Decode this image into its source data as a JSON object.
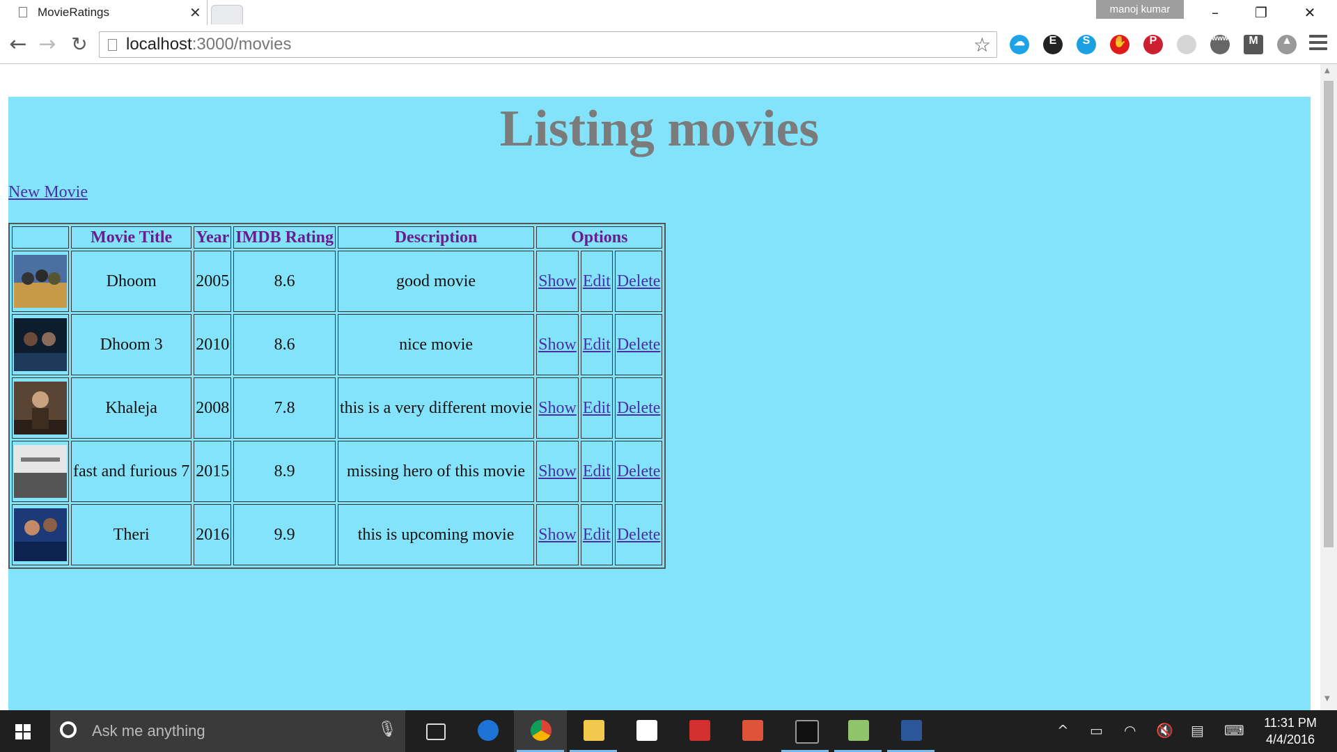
{
  "browser": {
    "tab_title": "MovieRatings",
    "tab_close": "✕",
    "user_name": "manoj kumar",
    "url_host": "localhost",
    "url_path": ":3000/movies"
  },
  "page": {
    "heading": "Listing movies",
    "new_movie_label": "New Movie",
    "columns": {
      "image": "",
      "title": "Movie Title",
      "year": "Year",
      "rating": "IMDB Rating",
      "description": "Description",
      "options": "Options"
    },
    "action_labels": {
      "show": "Show",
      "edit": "Edit",
      "delete": "Delete"
    },
    "movies": [
      {
        "title": "Dhoom",
        "year": "2005",
        "rating": "8.6",
        "description": "good movie"
      },
      {
        "title": "Dhoom 3",
        "year": "2010",
        "rating": "8.6",
        "description": "nice movie"
      },
      {
        "title": "Khaleja",
        "year": "2008",
        "rating": "7.8",
        "description": "this is a very different movie"
      },
      {
        "title": "fast and furious 7",
        "year": "2015",
        "rating": "8.9",
        "description": "missing hero of this movie"
      },
      {
        "title": "Theri",
        "year": "2016",
        "rating": "9.9",
        "description": "this is upcoming movie"
      }
    ]
  },
  "taskbar": {
    "search_placeholder": "Ask me anything",
    "time": "11:31 PM",
    "date": "4/4/2016"
  },
  "colors": {
    "page_background": "#82e3fa",
    "heading": "#7b7b7b",
    "header_text": "#6a1d8f",
    "link": "#4b2ea6"
  }
}
